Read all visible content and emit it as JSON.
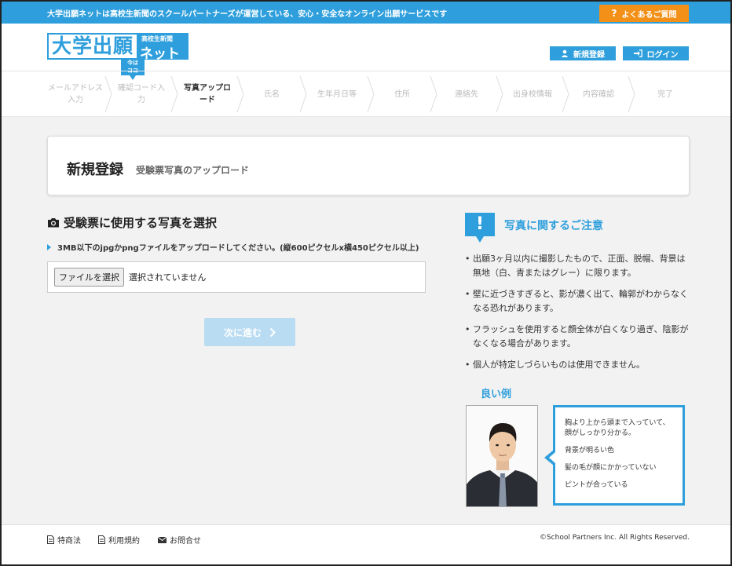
{
  "topbar": {
    "text": "大学出願ネットは高校生新聞のスクールパートナーズが運営している、安心・安全なオンライン出願サービスです",
    "faq_label": "よくあるご質問"
  },
  "logo": {
    "main": "大学出願",
    "sub_top": "高校生新聞",
    "sub_main": "ネット",
    "here_line1": "今は",
    "here_line2": "ココ"
  },
  "header": {
    "register_label": "新規登録",
    "login_label": "ログイン"
  },
  "steps": [
    {
      "label": "メールアドレス入力",
      "l1": "メールアドレス",
      "l2": "入力"
    },
    {
      "label": "確認コード入力",
      "l1": "確認コード入",
      "l2": "力"
    },
    {
      "label": "写真アップロード",
      "l1": "写真アップロ",
      "l2": "ード"
    },
    {
      "label": "氏名",
      "l1": "氏名",
      "l2": ""
    },
    {
      "label": "生年月日等",
      "l1": "生年月日等",
      "l2": ""
    },
    {
      "label": "住所",
      "l1": "住所",
      "l2": ""
    },
    {
      "label": "連絡先",
      "l1": "連絡先",
      "l2": ""
    },
    {
      "label": "出身校情報",
      "l1": "出身校情報",
      "l2": ""
    },
    {
      "label": "内容確認",
      "l1": "内容確認",
      "l2": ""
    },
    {
      "label": "完了",
      "l1": "完了",
      "l2": ""
    }
  ],
  "page": {
    "title": "新規登録",
    "subtitle": "受験票写真のアップロード"
  },
  "upload": {
    "heading": "受験票に使用する写真を選択",
    "note": "3MB以下のjpgかpngファイルをアップロードしてください。(縦600ピクセルx横450ピクセル以上)",
    "file_button": "ファイルを選択",
    "file_status": "選択されていません",
    "next_label": "次に進む"
  },
  "caution": {
    "title": "写真に関するご注意",
    "items": [
      "出願3ヶ月以内に撮影したもので、正面、脱帽、背景は無地（白、青またはグレー）に限ります。",
      "壁に近づきすぎると、影が濃く出て、輪郭がわからなくなる恐れがあります。",
      "フラッシュを使用すると顔全体が白くなり過ぎ、陰影がなくなる場合があります。",
      "個人が特定しづらいものは使用できません。"
    ]
  },
  "good_example": {
    "title": "良い例",
    "points": [
      "胸より上から頭まで入っていて、顔がしっかり分かる。",
      "背景が明るい色",
      "髪の毛が顔にかかっていない",
      "ピントが合っている"
    ]
  },
  "footer": {
    "links": [
      "特商法",
      "利用規約",
      "お問合せ"
    ],
    "copyright": "©School Partners Inc. All Rights Reserved."
  },
  "colors": {
    "brand_blue": "#2e9fdc",
    "faq_orange": "#f39018",
    "disabled_blue": "#b9dcf2"
  }
}
